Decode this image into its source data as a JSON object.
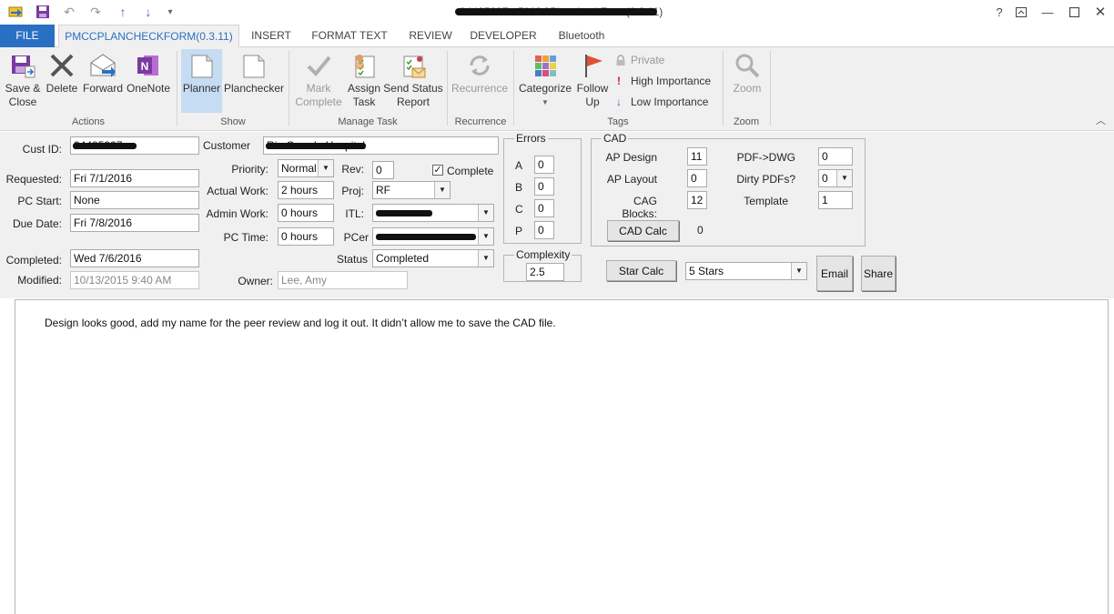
{
  "window": {
    "title": "94485327 - PMCCPlancheckForm(0.3.11)",
    "controls": [
      "?",
      "restore",
      "minimize",
      "maximize",
      "close"
    ]
  },
  "quick_access": [
    "app-icon",
    "save-icon",
    "undo-icon",
    "redo-icon",
    "up-arrow-icon",
    "down-arrow-icon",
    "customize-icon"
  ],
  "tabs": [
    {
      "label": "FILE"
    },
    {
      "label": "PMCCPLANCHECKFORM(0.3.11)"
    },
    {
      "label": "INSERT"
    },
    {
      "label": "FORMAT TEXT"
    },
    {
      "label": "REVIEW"
    },
    {
      "label": "DEVELOPER"
    },
    {
      "label": "Bluetooth"
    }
  ],
  "ribbon": {
    "actions": {
      "label": "Actions",
      "save_close": "Save &\nClose",
      "delete": "Delete",
      "forward": "Forward",
      "onenote": "OneNote"
    },
    "show": {
      "label": "Show",
      "planner": "Planner",
      "planchecker": "Planchecker"
    },
    "manage_task": {
      "label": "Manage Task",
      "mark_complete": "Mark\nComplete",
      "assign_task": "Assign\nTask",
      "send_status": "Send Status\nReport"
    },
    "recurrence": {
      "label": "Recurrence",
      "recurrence": "Recurrence"
    },
    "tags": {
      "label": "Tags",
      "categorize": "Categorize",
      "follow_up": "Follow\nUp",
      "private": "Private",
      "high_importance": "High Importance",
      "low_importance": "Low Importance"
    },
    "zoom": {
      "label": "Zoom",
      "zoom": "Zoom"
    }
  },
  "form": {
    "cust_id": {
      "label": "Cust ID:",
      "value": "94485327"
    },
    "customer": {
      "label": "Customer",
      "value": "Rio Grande Hospital"
    },
    "requested": {
      "label": "Requested:",
      "value": "Fri 7/1/2016"
    },
    "pc_start": {
      "label": "PC Start:",
      "value": "None"
    },
    "due_date": {
      "label": "Due Date:",
      "value": "Fri 7/8/2016"
    },
    "completed": {
      "label": "Completed:",
      "value": "Wed 7/6/2016"
    },
    "modified": {
      "label": "Modified:",
      "value": "10/13/2015 9:40 AM"
    },
    "priority": {
      "label": "Priority:",
      "value": "Normal"
    },
    "actual_work": {
      "label": "Actual Work:",
      "value": "2 hours"
    },
    "admin_work": {
      "label": "Admin Work:",
      "value": "0 hours"
    },
    "pc_time": {
      "label": "PC Time:",
      "value": "0 hours"
    },
    "rev": {
      "label": "Rev:",
      "value": "0"
    },
    "complete_check": {
      "label": "Complete",
      "checked": true
    },
    "proj": {
      "label": "Proj:",
      "value": "RF"
    },
    "itl": {
      "label": "ITL:",
      "value": ""
    },
    "pcer": {
      "label": "PCer",
      "value": ""
    },
    "status": {
      "label": "Status",
      "value": "Completed"
    },
    "owner": {
      "label": "Owner:",
      "value": "Lee, Amy"
    },
    "errors": {
      "title": "Errors",
      "rows": [
        {
          "label": "A",
          "value": "0"
        },
        {
          "label": "B",
          "value": "0"
        },
        {
          "label": "C",
          "value": "0"
        },
        {
          "label": "P",
          "value": "0"
        }
      ]
    },
    "complexity": {
      "title": "Complexity",
      "value": "2.5"
    },
    "cad": {
      "title": "CAD",
      "ap_design": {
        "label": "AP Design",
        "value": "11"
      },
      "ap_layout": {
        "label": "AP Layout",
        "value": "0"
      },
      "cag_blocks": {
        "label": "CAG Blocks:",
        "value": "12"
      },
      "pdf_dwg": {
        "label": "PDF->DWG",
        "value": "0"
      },
      "dirty_pdfs": {
        "label": "Dirty PDFs?",
        "value": "0"
      },
      "template": {
        "label": "Template",
        "value": "1"
      },
      "cad_calc_button": "CAD Calc",
      "cad_calc_result": "0"
    },
    "star_calc_button": "Star Calc",
    "stars": "5 Stars",
    "email_button": "Email",
    "share_button": "Share"
  },
  "body": {
    "text": "Design looks good, add my name for the peer review and log it out. It didn’t allow me to save the CAD file."
  },
  "colors": {
    "accent": "#2a70c2",
    "ribbon_bg": "#f0f0f0",
    "selected": "#c5dcf2"
  }
}
